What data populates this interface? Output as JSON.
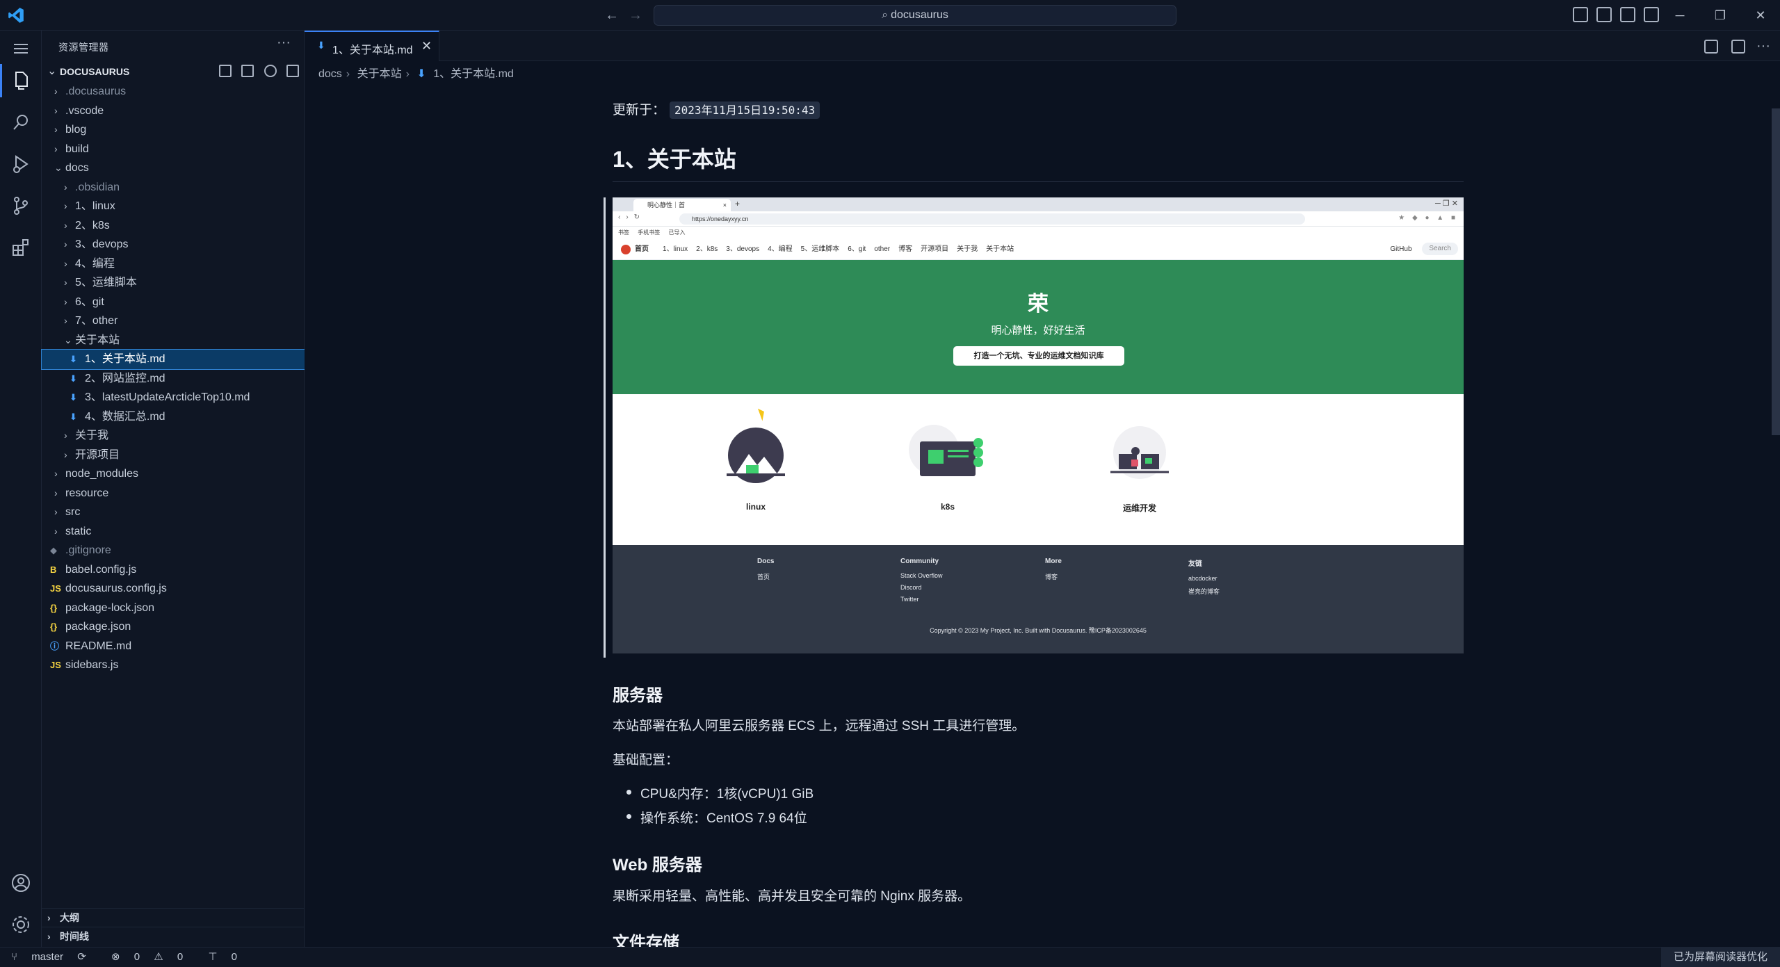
{
  "title_bar": {
    "search_text": "docusaurus",
    "back_label": "←",
    "forward_label": "→",
    "minimize": "─",
    "restore": "❐",
    "close": "✕"
  },
  "sidebar": {
    "header": "资源管理器",
    "more": "···",
    "root_label": "DOCUSAURUS",
    "tree": [
      {
        "label": ".docusaurus",
        "depth": 0,
        "kind": "folder",
        "dim": true
      },
      {
        "label": ".vscode",
        "depth": 0,
        "kind": "folder"
      },
      {
        "label": "blog",
        "depth": 0,
        "kind": "folder"
      },
      {
        "label": "build",
        "depth": 0,
        "kind": "folder"
      },
      {
        "label": "docs",
        "depth": 0,
        "kind": "folder-open"
      },
      {
        "label": ".obsidian",
        "depth": 1,
        "kind": "folder",
        "dim": true
      },
      {
        "label": "1、linux",
        "depth": 1,
        "kind": "folder"
      },
      {
        "label": "2、k8s",
        "depth": 1,
        "kind": "folder"
      },
      {
        "label": "3、devops",
        "depth": 1,
        "kind": "folder"
      },
      {
        "label": "4、编程",
        "depth": 1,
        "kind": "folder"
      },
      {
        "label": "5、运维脚本",
        "depth": 1,
        "kind": "folder"
      },
      {
        "label": "6、git",
        "depth": 1,
        "kind": "folder"
      },
      {
        "label": "7、other",
        "depth": 1,
        "kind": "folder"
      },
      {
        "label": "关于本站",
        "depth": 1,
        "kind": "folder-open"
      },
      {
        "label": "1、关于本站.md",
        "depth": 2,
        "kind": "md",
        "selected": true
      },
      {
        "label": "2、网站监控.md",
        "depth": 2,
        "kind": "md"
      },
      {
        "label": "3、latestUpdateArcticleTop10.md",
        "depth": 2,
        "kind": "md"
      },
      {
        "label": "4、数据汇总.md",
        "depth": 2,
        "kind": "md"
      },
      {
        "label": "关于我",
        "depth": 1,
        "kind": "folder"
      },
      {
        "label": "开源项目",
        "depth": 1,
        "kind": "folder"
      },
      {
        "label": "node_modules",
        "depth": 0,
        "kind": "folder"
      },
      {
        "label": "resource",
        "depth": 0,
        "kind": "folder"
      },
      {
        "label": "src",
        "depth": 0,
        "kind": "folder"
      },
      {
        "label": "static",
        "depth": 0,
        "kind": "folder"
      },
      {
        "label": ".gitignore",
        "depth": 0,
        "kind": "git",
        "dim": true
      },
      {
        "label": "babel.config.js",
        "depth": 0,
        "kind": "babel"
      },
      {
        "label": "docusaurus.config.js",
        "depth": 0,
        "kind": "js"
      },
      {
        "label": "package-lock.json",
        "depth": 0,
        "kind": "json"
      },
      {
        "label": "package.json",
        "depth": 0,
        "kind": "json"
      },
      {
        "label": "README.md",
        "depth": 0,
        "kind": "info"
      },
      {
        "label": "sidebars.js",
        "depth": 0,
        "kind": "js"
      }
    ],
    "outline": "大纲",
    "timeline": "时间线"
  },
  "editor": {
    "tab_label": "1、关于本站.md",
    "tab_close": "✕",
    "breadcrumb": [
      "docs",
      "关于本站",
      "1、关于本站.md"
    ],
    "more": "···"
  },
  "doc": {
    "updated_label": "更新于：",
    "updated_value": "2023年11月15日19:50:43",
    "h1": "1、关于本站",
    "server_h2": "服务器",
    "server_p": "本站部署在私人阿里云服务器 ECS 上，远程通过 SSH 工具进行管理。",
    "config_label": "基础配置：",
    "config_items": [
      "CPU&内存：1核(vCPU)1 GiB",
      "操作系统：CentOS 7.9 64位"
    ],
    "web_h2": "Web 服务器",
    "web_p": "果断采用轻量、高性能、高并发且安全可靠的 Nginx 服务器。",
    "storage_h2": "文件存储"
  },
  "embedded_site": {
    "browser_tab": "明心静性｜首",
    "url": "https://onedayxyy.cn",
    "bookmarks": [
      "书签",
      "手机书签",
      "已导入"
    ],
    "nav_home": "首页",
    "nav_items": [
      "1、linux",
      "2、k8s",
      "3、devops",
      "4、编程",
      "5、运维脚本",
      "6、git",
      "other",
      "博客",
      "开源项目",
      "关于我",
      "关于本站"
    ],
    "nav_github": "GitHub",
    "nav_search": "Search",
    "hero_title": "荣",
    "hero_subtitle": "明心静性，好好生活",
    "hero_button": "打造一个无坑、专业的运维文档知识库",
    "features": [
      "linux",
      "k8s",
      "运维开发"
    ],
    "footer": {
      "cols": [
        {
          "title": "Docs",
          "links": [
            "首页"
          ]
        },
        {
          "title": "Community",
          "links": [
            "Stack Overflow",
            "Discord",
            "Twitter"
          ]
        },
        {
          "title": "More",
          "links": [
            "博客"
          ]
        },
        {
          "title": "友链",
          "links": [
            "abcdocker",
            "崔亮的博客"
          ]
        }
      ],
      "copyright": "Copyright © 2023 My Project, Inc. Built with Docusaurus. 豫ICP备2023002645"
    }
  },
  "status_bar": {
    "branch": "master",
    "errors": "0",
    "warnings": "0",
    "ports": "0",
    "right": "已为屏幕阅读器优化"
  },
  "colors": {
    "accent": "#3b82f6",
    "selection": "#0b3b66",
    "hero_green": "#2e8b57",
    "markdown_icon": "#4aa3ff"
  }
}
